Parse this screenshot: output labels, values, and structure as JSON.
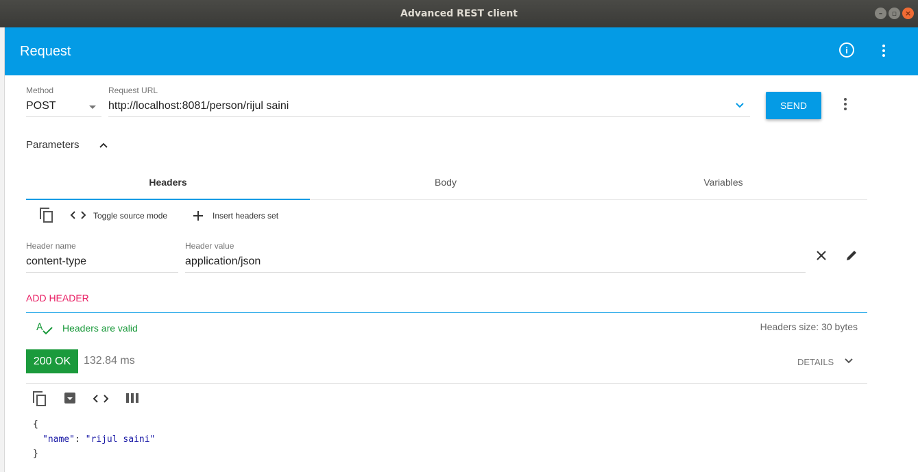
{
  "window": {
    "title": "Advanced REST client"
  },
  "appbar": {
    "title": "Request",
    "info_icon": "info-icon",
    "more_icon": "more-vert-icon"
  },
  "request": {
    "method_label": "Method",
    "method_value": "POST",
    "url_label": "Request URL",
    "url_value": "http://localhost:8081/person/rijul saini",
    "send_label": "SEND"
  },
  "parameters": {
    "label": "Parameters"
  },
  "tabs": [
    {
      "label": "Headers",
      "active": true
    },
    {
      "label": "Body",
      "active": false
    },
    {
      "label": "Variables",
      "active": false
    }
  ],
  "headers_toolbar": {
    "toggle_source_label": "Toggle source mode",
    "insert_set_label": "Insert headers set"
  },
  "header_row": {
    "name_label": "Header name",
    "name_value": "content-type",
    "value_label": "Header value",
    "value_value": "application/json"
  },
  "add_header_label": "ADD HEADER",
  "validation": {
    "valid_text": "Headers are valid",
    "size_text": "Headers size: 30 bytes"
  },
  "response": {
    "status": "200 OK",
    "time": "132.84 ms",
    "details_label": "DETAILS",
    "body_lines": {
      "open": "{",
      "key": "\"name\"",
      "sep": ": ",
      "value": "\"rijul saini\"",
      "close": "}"
    }
  },
  "colors": {
    "accent": "#049be5",
    "add_header": "#e91e63",
    "valid": "#1b9a3c",
    "status_ok": "#1b9a3c"
  }
}
